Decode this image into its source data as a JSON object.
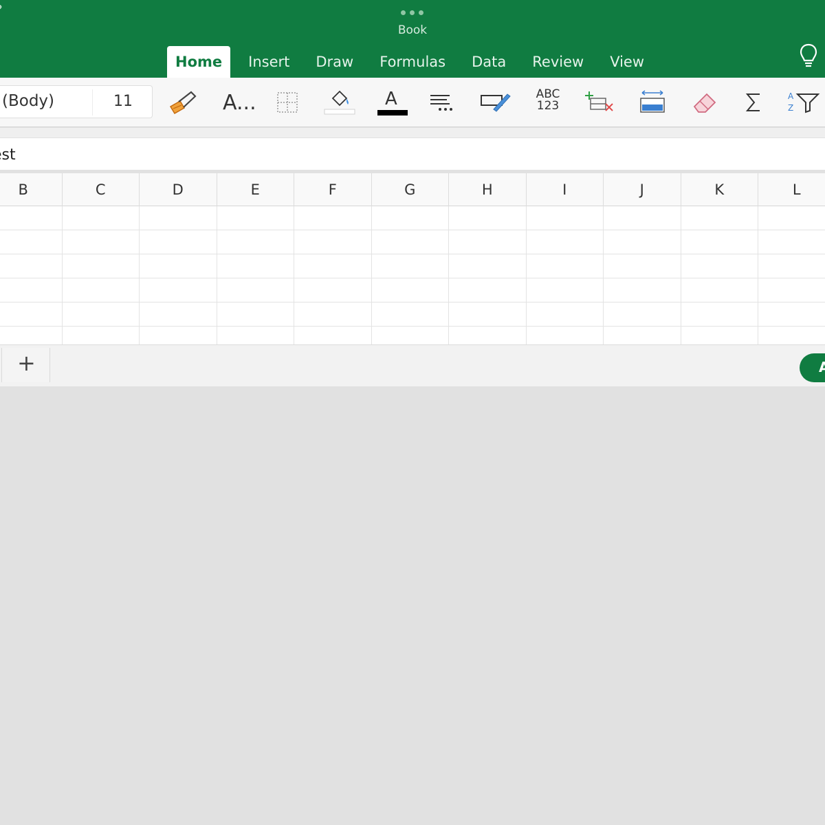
{
  "app": {
    "title": "Book",
    "edge_glyph": "?",
    "accent": "#107c41"
  },
  "tabs": [
    "Home",
    "Insert",
    "Draw",
    "Formulas",
    "Data",
    "Review",
    "View"
  ],
  "ribbon": {
    "font_name": "(Body)",
    "font_size": "11",
    "font_style_label": "A...",
    "font_color_label": "A",
    "number_format_top": "ABC",
    "number_format_bottom": "123",
    "sort_a": "A",
    "sort_z": "Z",
    "icons": [
      "format-painter-icon",
      "font-style-icon",
      "borders-icon",
      "fill-color-icon",
      "font-color-icon",
      "alignment-icon",
      "cell-style-icon",
      "number-format-icon",
      "insert-delete-icon",
      "fit-columns-icon",
      "clear-icon",
      "autosum-icon",
      "sort-filter-icon"
    ]
  },
  "formula_bar": {
    "value": "est"
  },
  "columns": [
    "B",
    "C",
    "D",
    "E",
    "F",
    "G",
    "H",
    "I",
    "J",
    "K",
    "L"
  ],
  "sheet_bar": {
    "add_label": "+",
    "pill_label": "A"
  }
}
